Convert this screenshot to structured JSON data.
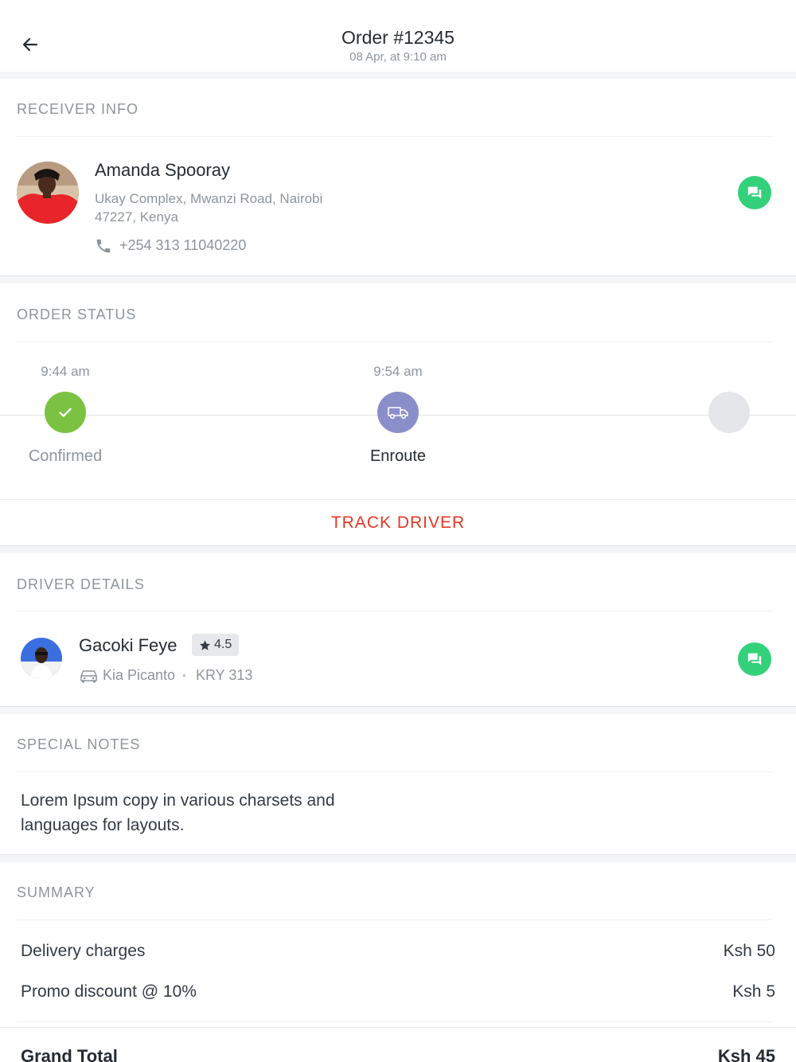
{
  "header": {
    "title": "Order #12345",
    "subtitle": "08 Apr, at 9:10 am"
  },
  "receiver": {
    "section_label": "RECEIVER INFO",
    "name": "Amanda Spooray",
    "address_line1": "Ukay Complex, Mwanzi Road, Nairobi",
    "address_line2": "47227, Kenya",
    "phone": "+254 313 11040220"
  },
  "order_status": {
    "section_label": "ORDER STATUS",
    "steps": [
      {
        "time": "9:44 am",
        "label": "Confirmed",
        "state": "done"
      },
      {
        "time": "9:54 am",
        "label": "Enroute",
        "state": "current"
      },
      {
        "time": "",
        "label": "",
        "state": "pending"
      }
    ],
    "track_label": "TRACK DRIVER"
  },
  "driver": {
    "section_label": "DRIVER DETAILS",
    "name": "Gacoki Feye",
    "rating": "4.5",
    "car": "Kia Picanto",
    "separator": "•",
    "plate": "KRY 313"
  },
  "notes": {
    "section_label": "SPECIAL NOTES",
    "line1": "Lorem Ipsum copy in various charsets and",
    "line2": "languages for layouts."
  },
  "summary": {
    "section_label": "SUMMARY",
    "rows": [
      {
        "label": "Delivery charges",
        "amount": "Ksh 50"
      },
      {
        "label": "Promo discount @ 10%",
        "amount": "Ksh 5"
      }
    ],
    "total_label": "Grand Total",
    "total_amount": "Ksh 45"
  },
  "colors": {
    "accent_red": "#e53722",
    "chat_green": "#33d17a",
    "confirmed_green": "#7cc242",
    "enroute_purple": "#8a8fc9",
    "pending_grey": "#e4e6e9"
  },
  "icons": [
    "back-arrow-icon",
    "chat-icon",
    "phone-icon",
    "check-icon",
    "van-icon",
    "star-icon",
    "car-icon"
  ]
}
